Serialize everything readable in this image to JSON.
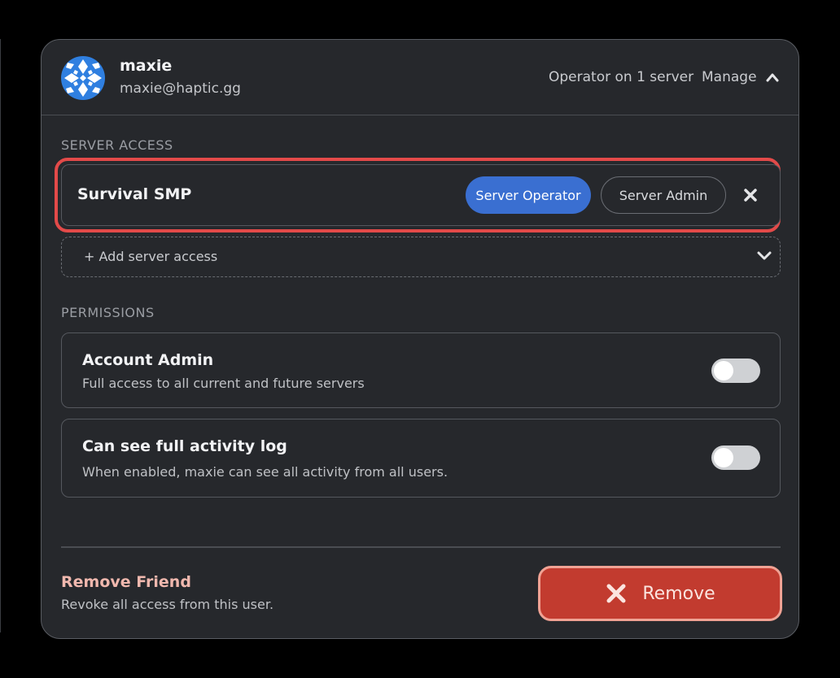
{
  "user": {
    "name": "maxie",
    "email": "maxie@haptic.gg",
    "avatar_colors": [
      "#2f7fe0",
      "#ffffff"
    ]
  },
  "header": {
    "operator_summary": "Operator on 1 server",
    "manage_label": "Manage",
    "manage_icon": "chevron-up-icon"
  },
  "server_access": {
    "section_label": "SERVER ACCESS",
    "servers": [
      {
        "name": "Survival SMP",
        "roles": [
          {
            "label": "Server Operator",
            "selected": true
          },
          {
            "label": "Server Admin",
            "selected": false
          }
        ],
        "remove_icon": "close-icon"
      }
    ],
    "add_label": "+ Add server access",
    "add_icon": "chevron-down-icon"
  },
  "permissions": {
    "section_label": "PERMISSIONS",
    "items": [
      {
        "title": "Account Admin",
        "description": "Full access to all current and future servers",
        "enabled": false
      },
      {
        "title": "Can see full activity log",
        "description": "When enabled, maxie can see all activity from all users.",
        "enabled": false
      }
    ]
  },
  "remove_friend": {
    "title": "Remove Friend",
    "description": "Revoke all access from this user.",
    "button_label": "Remove",
    "button_icon": "close-icon"
  },
  "colors": {
    "background": "#000000",
    "card": "#26282c",
    "accent_blue": "#3a6fd1",
    "danger": "#c23b2f",
    "highlight": "#e34a49"
  }
}
